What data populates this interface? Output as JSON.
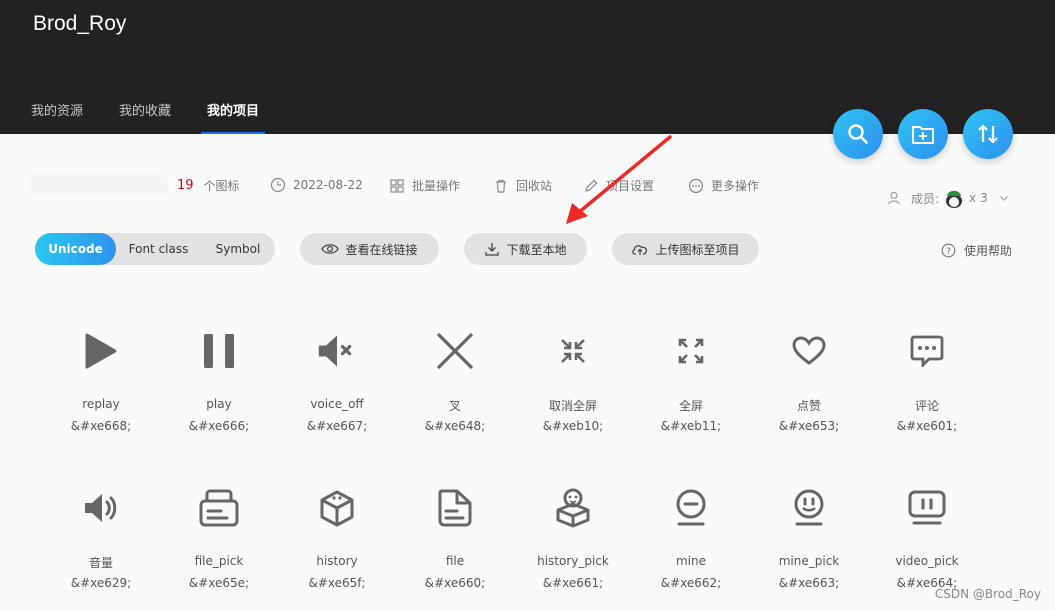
{
  "header": {
    "brand": "Brod_Roy",
    "tabs": [
      {
        "label": "我的资源"
      },
      {
        "label": "我的收藏"
      },
      {
        "label": "我的项目",
        "active": true
      }
    ],
    "accent_color": "#1e6bff"
  },
  "fabs": [
    {
      "icon": "search-icon"
    },
    {
      "icon": "add-folder-icon"
    },
    {
      "icon": "sort-icon"
    }
  ],
  "project": {
    "icon_count": "19",
    "icon_count_suffix": "个图标",
    "date": "2022-08-22",
    "batch": "批量操作",
    "recycle": "回收站",
    "settings": "项目设置",
    "more": "更多操作",
    "members_label": "成员:",
    "members_count": "x 3"
  },
  "toolbar": {
    "segments": [
      "Unicode",
      "Font class",
      "Symbol"
    ],
    "active_segment": "Unicode",
    "view_link": "查看在线链接",
    "download": "下载至本地",
    "upload": "上传图标至项目",
    "help": "使用帮助"
  },
  "icons": [
    {
      "name": "replay",
      "code": "&#xe668;",
      "icon": "play-triangle-icon"
    },
    {
      "name": "play",
      "code": "&#xe666;",
      "icon": "pause-icon"
    },
    {
      "name": "voice_off",
      "code": "&#xe667;",
      "icon": "speaker-mute-icon"
    },
    {
      "name": "叉",
      "code": "&#xe648;",
      "icon": "cross-icon"
    },
    {
      "name": "取消全屏",
      "code": "&#xeb10;",
      "icon": "exit-fullscreen-icon"
    },
    {
      "name": "全屏",
      "code": "&#xeb11;",
      "icon": "fullscreen-icon"
    },
    {
      "name": "点赞",
      "code": "&#xe653;",
      "icon": "heart-icon"
    },
    {
      "name": "评论",
      "code": "&#xe601;",
      "icon": "comment-icon"
    },
    {
      "name": "音量",
      "code": "&#xe629;",
      "icon": "speaker-volume-icon"
    },
    {
      "name": "file_pick",
      "code": "&#xe65e;",
      "icon": "file-pick-icon"
    },
    {
      "name": "history",
      "code": "&#xe65f;",
      "icon": "history-box-icon"
    },
    {
      "name": "file",
      "code": "&#xe660;",
      "icon": "file-icon"
    },
    {
      "name": "history_pick",
      "code": "&#xe661;",
      "icon": "history-pick-icon"
    },
    {
      "name": "mine",
      "code": "&#xe662;",
      "icon": "mine-icon"
    },
    {
      "name": "mine_pick",
      "code": "&#xe663;",
      "icon": "mine-pick-icon"
    },
    {
      "name": "video_pick",
      "code": "&#xe664;",
      "icon": "video-pick-icon"
    }
  ],
  "watermark": "CSDN @Brod_Roy",
  "annotation_color": "#ee2a24"
}
